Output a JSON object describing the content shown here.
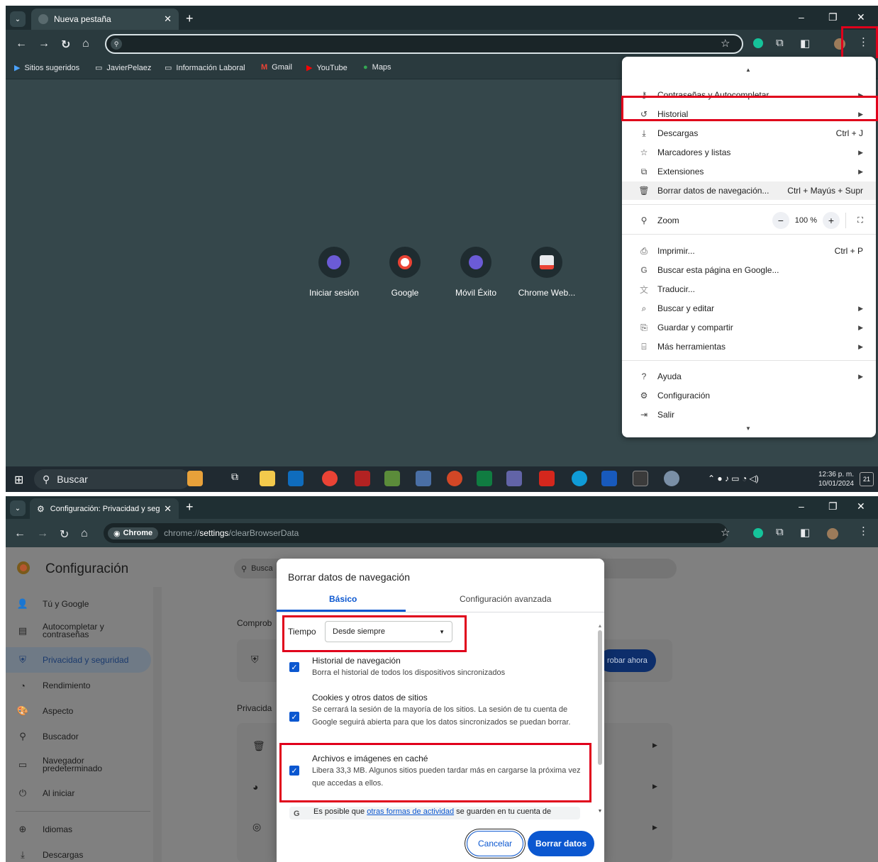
{
  "top": {
    "tab": {
      "title": "Nueva pestaña"
    },
    "bookmarks": [
      {
        "label": "Sitios sugeridos",
        "icon": "suggested-icon"
      },
      {
        "label": "JavierPelaez",
        "icon": "folder-icon"
      },
      {
        "label": "Información Laboral",
        "icon": "folder-icon"
      },
      {
        "label": "Gmail",
        "icon": "gmail-icon"
      },
      {
        "label": "YouTube",
        "icon": "youtube-icon"
      },
      {
        "label": "Maps",
        "icon": "maps-icon"
      }
    ],
    "shortcuts": [
      {
        "label": "Iniciar sesión",
        "color": "#6b5bd6"
      },
      {
        "label": "Google",
        "color": "#ea4335"
      },
      {
        "label": "Móvil Éxito",
        "color": "#6b5bd6"
      },
      {
        "label": "Chrome Web...",
        "color": "#e8eaed"
      }
    ],
    "menu": {
      "items": [
        {
          "label": "Contraseñas y Autocompletar",
          "shortcut": ""
        },
        {
          "label": "Historial",
          "shortcut": ""
        },
        {
          "label": "Descargas",
          "shortcut": "Ctrl + J"
        },
        {
          "label": "Marcadores y listas",
          "shortcut": ""
        },
        {
          "label": "Extensiones",
          "shortcut": ""
        },
        {
          "label": "Borrar datos de navegación...",
          "shortcut": "Ctrl + Mayús + Supr"
        },
        {
          "label": "Zoom",
          "shortcut": ""
        },
        {
          "label": "Imprimir...",
          "shortcut": "Ctrl + P"
        },
        {
          "label": "Buscar esta página en Google...",
          "shortcut": ""
        },
        {
          "label": "Traducir...",
          "shortcut": ""
        },
        {
          "label": "Buscar y editar",
          "shortcut": ""
        },
        {
          "label": "Guardar y compartir",
          "shortcut": ""
        },
        {
          "label": "Más herramientas",
          "shortcut": ""
        },
        {
          "label": "Ayuda",
          "shortcut": ""
        },
        {
          "label": "Configuración",
          "shortcut": ""
        },
        {
          "label": "Salir",
          "shortcut": ""
        }
      ],
      "zoom_value": "100 %"
    },
    "taskbar": {
      "search": "Buscar",
      "time": "12:36 p. m.",
      "date": "10/01/2024",
      "notifications": "21"
    }
  },
  "bottom": {
    "tab": {
      "title": "Configuración: Privacidad y seg"
    },
    "chip": "Chrome",
    "url_prefix": "chrome://",
    "url_host": "settings",
    "url_path": "/clearBrowserData",
    "settings_title": "Configuración",
    "search_placeholder": "Busca",
    "sidebar": [
      {
        "label": "Tú y Google"
      },
      {
        "label": "Autocompletar y contraseñas"
      },
      {
        "label": "Privacidad y seguridad"
      },
      {
        "label": "Rendimiento"
      },
      {
        "label": "Aspecto"
      },
      {
        "label": "Buscador"
      },
      {
        "label": "Navegador predeterminado"
      },
      {
        "label": "Al iniciar"
      },
      {
        "label": "Idiomas"
      },
      {
        "label": "Descargas"
      }
    ],
    "bg_labels": {
      "check": "Comprob",
      "check_button": "robar ahora",
      "privacy": "Privacida"
    },
    "dialog": {
      "title": "Borrar datos de navegación",
      "tab_basic": "Básico",
      "tab_advanced": "Configuración avanzada",
      "time_label": "Tiempo",
      "time_value": "Desde siempre",
      "options": [
        {
          "title": "Historial de navegación",
          "desc": "Borra el historial de todos los dispositivos sincronizados"
        },
        {
          "title": "Cookies y otros datos de sitios",
          "desc": "Se cerrará la sesión de la mayoría de los sitios. La sesión de tu cuenta de Google seguirá abierta para que los datos sincronizados se puedan borrar."
        },
        {
          "title": "Archivos e imágenes en caché",
          "desc": "Libera 33,3 MB. Algunos sitios pueden tardar más en cargarse la próxima vez que accedas a ellos."
        }
      ],
      "footer_note_pre": "Es posible que ",
      "footer_note_link": "otras formas de actividad",
      "footer_note_post": " se guarden en tu cuenta de",
      "cancel": "Cancelar",
      "clear": "Borrar datos"
    }
  }
}
